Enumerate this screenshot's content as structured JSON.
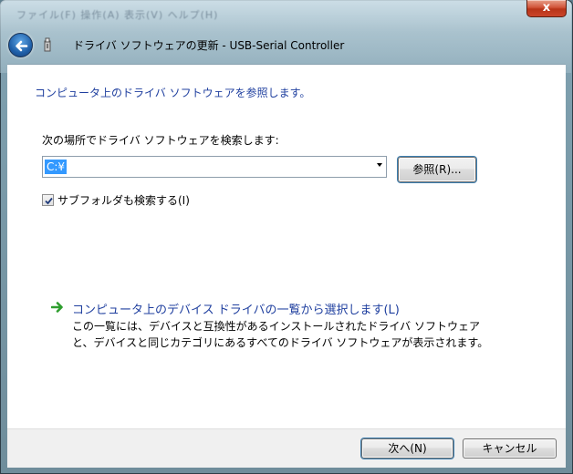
{
  "window": {
    "title": "ドライバ ソフトウェアの更新 - USB-Serial Controller",
    "close_label": "x",
    "background_menu_text": "ファイル(F)   操作(A)   表示(V)   ヘルプ(H)"
  },
  "page": {
    "heading": "コンピュータ上のドライバ ソフトウェアを参照します。",
    "search_label": "次の場所でドライバ ソフトウェアを検索します:",
    "path_value": "C:¥",
    "browse_label": "参照(R)...",
    "subfolder_label": "サブフォルダも検索する(I)",
    "subfolder_checked": true,
    "pick_link": "コンピュータ上のデバイス ドライバの一覧から選択します(L)",
    "pick_desc_line1": "この一覧には、デバイスと互換性があるインストールされたドライバ ソフトウェア",
    "pick_desc_line2": "と、デバイスと同じカテゴリにあるすべてのドライバ ソフトウェアが表示されます。"
  },
  "footer": {
    "next_label": "次へ(N)",
    "cancel_label": "キャンセル"
  },
  "icons": {
    "back": "back-arrow-icon",
    "device": "usb-device-icon",
    "link_arrow": "green-arrow-icon",
    "dropdown": "chevron-down-icon",
    "check": "checkmark-icon"
  },
  "colors": {
    "link_blue": "#1f3f9f",
    "selection_blue": "#3399ff",
    "arrow_green": "#2e9e2e"
  }
}
